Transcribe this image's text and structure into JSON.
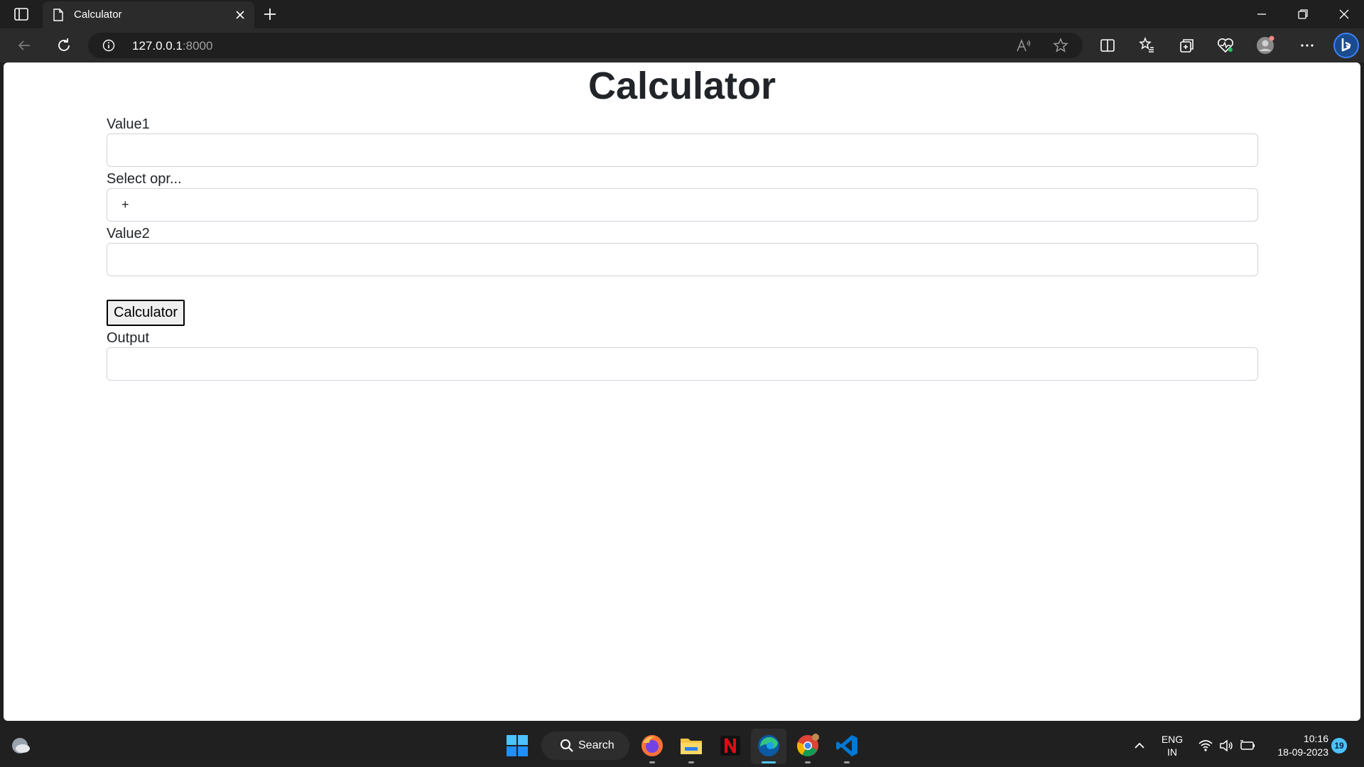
{
  "browser": {
    "tab_title": "Calculator",
    "url_host": "127.0.0.1",
    "url_port": ":8000"
  },
  "page": {
    "title": "Calculator",
    "value1_label": "Value1",
    "value1_value": "",
    "operator_label": "Select opr...",
    "operator_value": "+",
    "value2_label": "Value2",
    "value2_value": "",
    "submit_label": "Calculator",
    "output_label": "Output",
    "output_value": ""
  },
  "taskbar": {
    "search_label": "Search",
    "language_top": "ENG",
    "language_bottom": "IN",
    "time": "10:16",
    "date": "18-09-2023",
    "notification_count": "19"
  },
  "icons": {
    "tab_actions": "tab-actions-icon",
    "favicon": "document-icon",
    "weather": "weather-icon",
    "start": "windows-start-icon",
    "firefox": "firefox-icon",
    "explorer": "folder-icon",
    "netflix": "netflix-icon",
    "edge": "edge-icon",
    "chrome": "chrome-icon",
    "vscode": "vscode-icon"
  }
}
